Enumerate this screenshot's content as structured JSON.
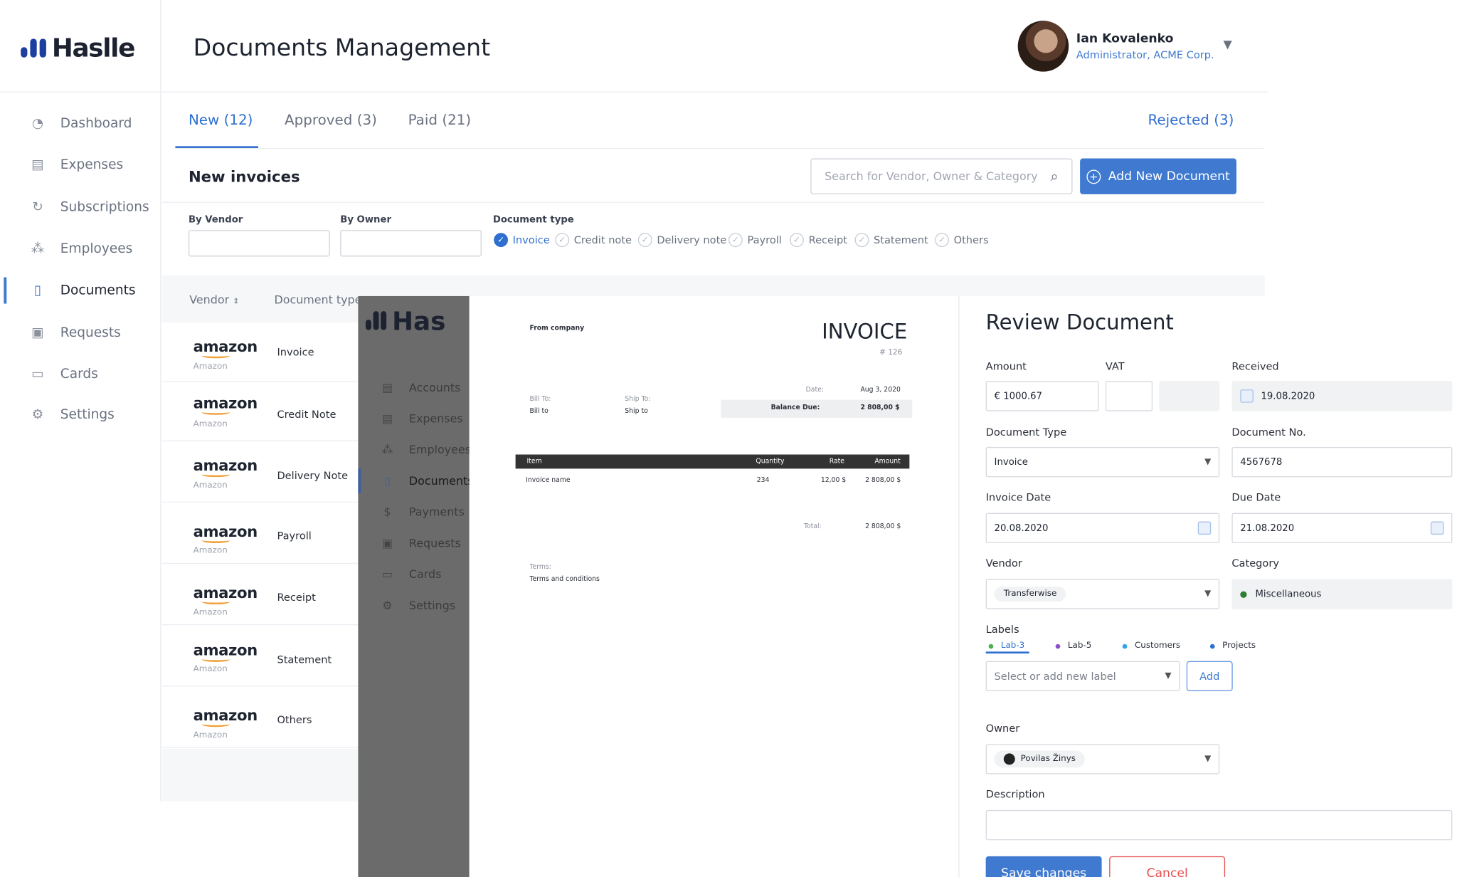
{
  "brand": {
    "name": "Haslle",
    "color": "#1f3f9f"
  },
  "dim_brand": {
    "name": "Has"
  },
  "header": {
    "title": "Documents Management",
    "user": {
      "name": "Ian Kovalenko",
      "role": "Administrator, ACME Corp."
    }
  },
  "sidebar": {
    "items": [
      {
        "label": "Dashboard",
        "icon": "dashboard-icon",
        "active": false
      },
      {
        "label": "Expenses",
        "icon": "expenses-icon",
        "active": false
      },
      {
        "label": "Subscriptions",
        "icon": "subscriptions-icon",
        "active": false
      },
      {
        "label": "Employees",
        "icon": "employees-icon",
        "active": false
      },
      {
        "label": "Documents",
        "icon": "documents-icon",
        "active": true
      },
      {
        "label": "Requests",
        "icon": "requests-icon",
        "active": false
      },
      {
        "label": "Cards",
        "icon": "cards-icon",
        "active": false
      },
      {
        "label": "Settings",
        "icon": "gear-icon",
        "active": false
      }
    ]
  },
  "tabs": {
    "new": "New",
    "new_count": "(12)",
    "approved": "Approved",
    "approved_count": "(3)",
    "paid": "Paid",
    "paid_count": "(21)",
    "rejected": "Rejected",
    "rejected_count": "(3)"
  },
  "section": {
    "title": "New invoices",
    "search_placeholder": "Search for Vendor, Owner & Category",
    "add_button": "Add New Document"
  },
  "filters": {
    "by_vendor": "By Vendor",
    "by_owner": "By Owner",
    "doc_type_label": "Document type",
    "doc_types": [
      {
        "label": "Invoice",
        "checked": true
      },
      {
        "label": "Credit note",
        "checked": false
      },
      {
        "label": "Delivery note",
        "checked": false
      },
      {
        "label": "Payroll",
        "checked": false
      },
      {
        "label": "Receipt",
        "checked": false
      },
      {
        "label": "Statement",
        "checked": false
      },
      {
        "label": "Others",
        "checked": false
      }
    ]
  },
  "table": {
    "columns": [
      "Vendor",
      "Document type"
    ],
    "rows": [
      {
        "vendor_logo": "amazon",
        "vendor": "Amazon",
        "type": "Invoice"
      },
      {
        "vendor_logo": "amazon",
        "vendor": "Amazon",
        "type": "Credit Note"
      },
      {
        "vendor_logo": "amazon",
        "vendor": "Amazon",
        "type": "Delivery Note"
      },
      {
        "vendor_logo": "amazon",
        "vendor": "Amazon",
        "type": "Payroll"
      },
      {
        "vendor_logo": "amazon",
        "vendor": "Amazon",
        "type": "Receipt"
      },
      {
        "vendor_logo": "amazon",
        "vendor": "Amazon",
        "type": "Statement"
      },
      {
        "vendor_logo": "amazon",
        "vendor": "Amazon",
        "type": "Others"
      }
    ]
  },
  "dim_nav": {
    "items": [
      "Accounts",
      "Expenses",
      "Employees",
      "Documents",
      "Payments",
      "Requests",
      "Cards",
      "Settings"
    ]
  },
  "invoice": {
    "from_company": "From company",
    "title": "INVOICE",
    "number": "# 126",
    "bill_to_label": "Bill To:",
    "bill_to": "Bill to",
    "ship_to_label": "Ship To:",
    "ship_to": "Ship to",
    "date_label": "Date:",
    "date": "Aug 3, 2020",
    "balance_label": "Balance Due:",
    "balance": "2 808,00 $",
    "head_item": "Item",
    "head_qty": "Quantity",
    "head_rate": "Rate",
    "head_amount": "Amount",
    "line_name": "Invoice name",
    "line_qty": "234",
    "line_rate": "12,00 $",
    "line_amount": "2 808,00 $",
    "total_label": "Total:",
    "total": "2 808,00 $",
    "terms_label": "Terms:",
    "terms": "Terms and conditions"
  },
  "review": {
    "title": "Review Document",
    "amount_label": "Amount",
    "amount": "€ 1000.67",
    "vat_label": "VAT",
    "received_label": "Received",
    "received": "19.08.2020",
    "doc_type_label": "Document Type",
    "doc_type": "Invoice",
    "doc_no_label": "Document No.",
    "doc_no": "4567678",
    "invoice_date_label": "Invoice Date",
    "invoice_date": "20.08.2020",
    "due_date_label": "Due Date",
    "due_date": "21.08.2020",
    "vendor_label": "Vendor",
    "vendor": "Transferwise",
    "category_label": "Category",
    "category": "Miscellaneous",
    "labels_label": "Labels",
    "labels": [
      {
        "name": "Lab-3",
        "color": "#4caf50"
      },
      {
        "name": "Lab-5",
        "color": "#8e4ec6"
      },
      {
        "name": "Customers",
        "color": "#2fa4e7"
      },
      {
        "name": "Projects",
        "color": "#2f6fd0"
      }
    ],
    "label_placeholder": "Select or add new label",
    "add": "Add",
    "owner_label": "Owner",
    "owner": "Povilas Žinys",
    "description_label": "Description",
    "save": "Save changes",
    "cancel": "Cancel"
  },
  "colors": {
    "accent": "#3f7ad0",
    "danger": "#e55050"
  }
}
